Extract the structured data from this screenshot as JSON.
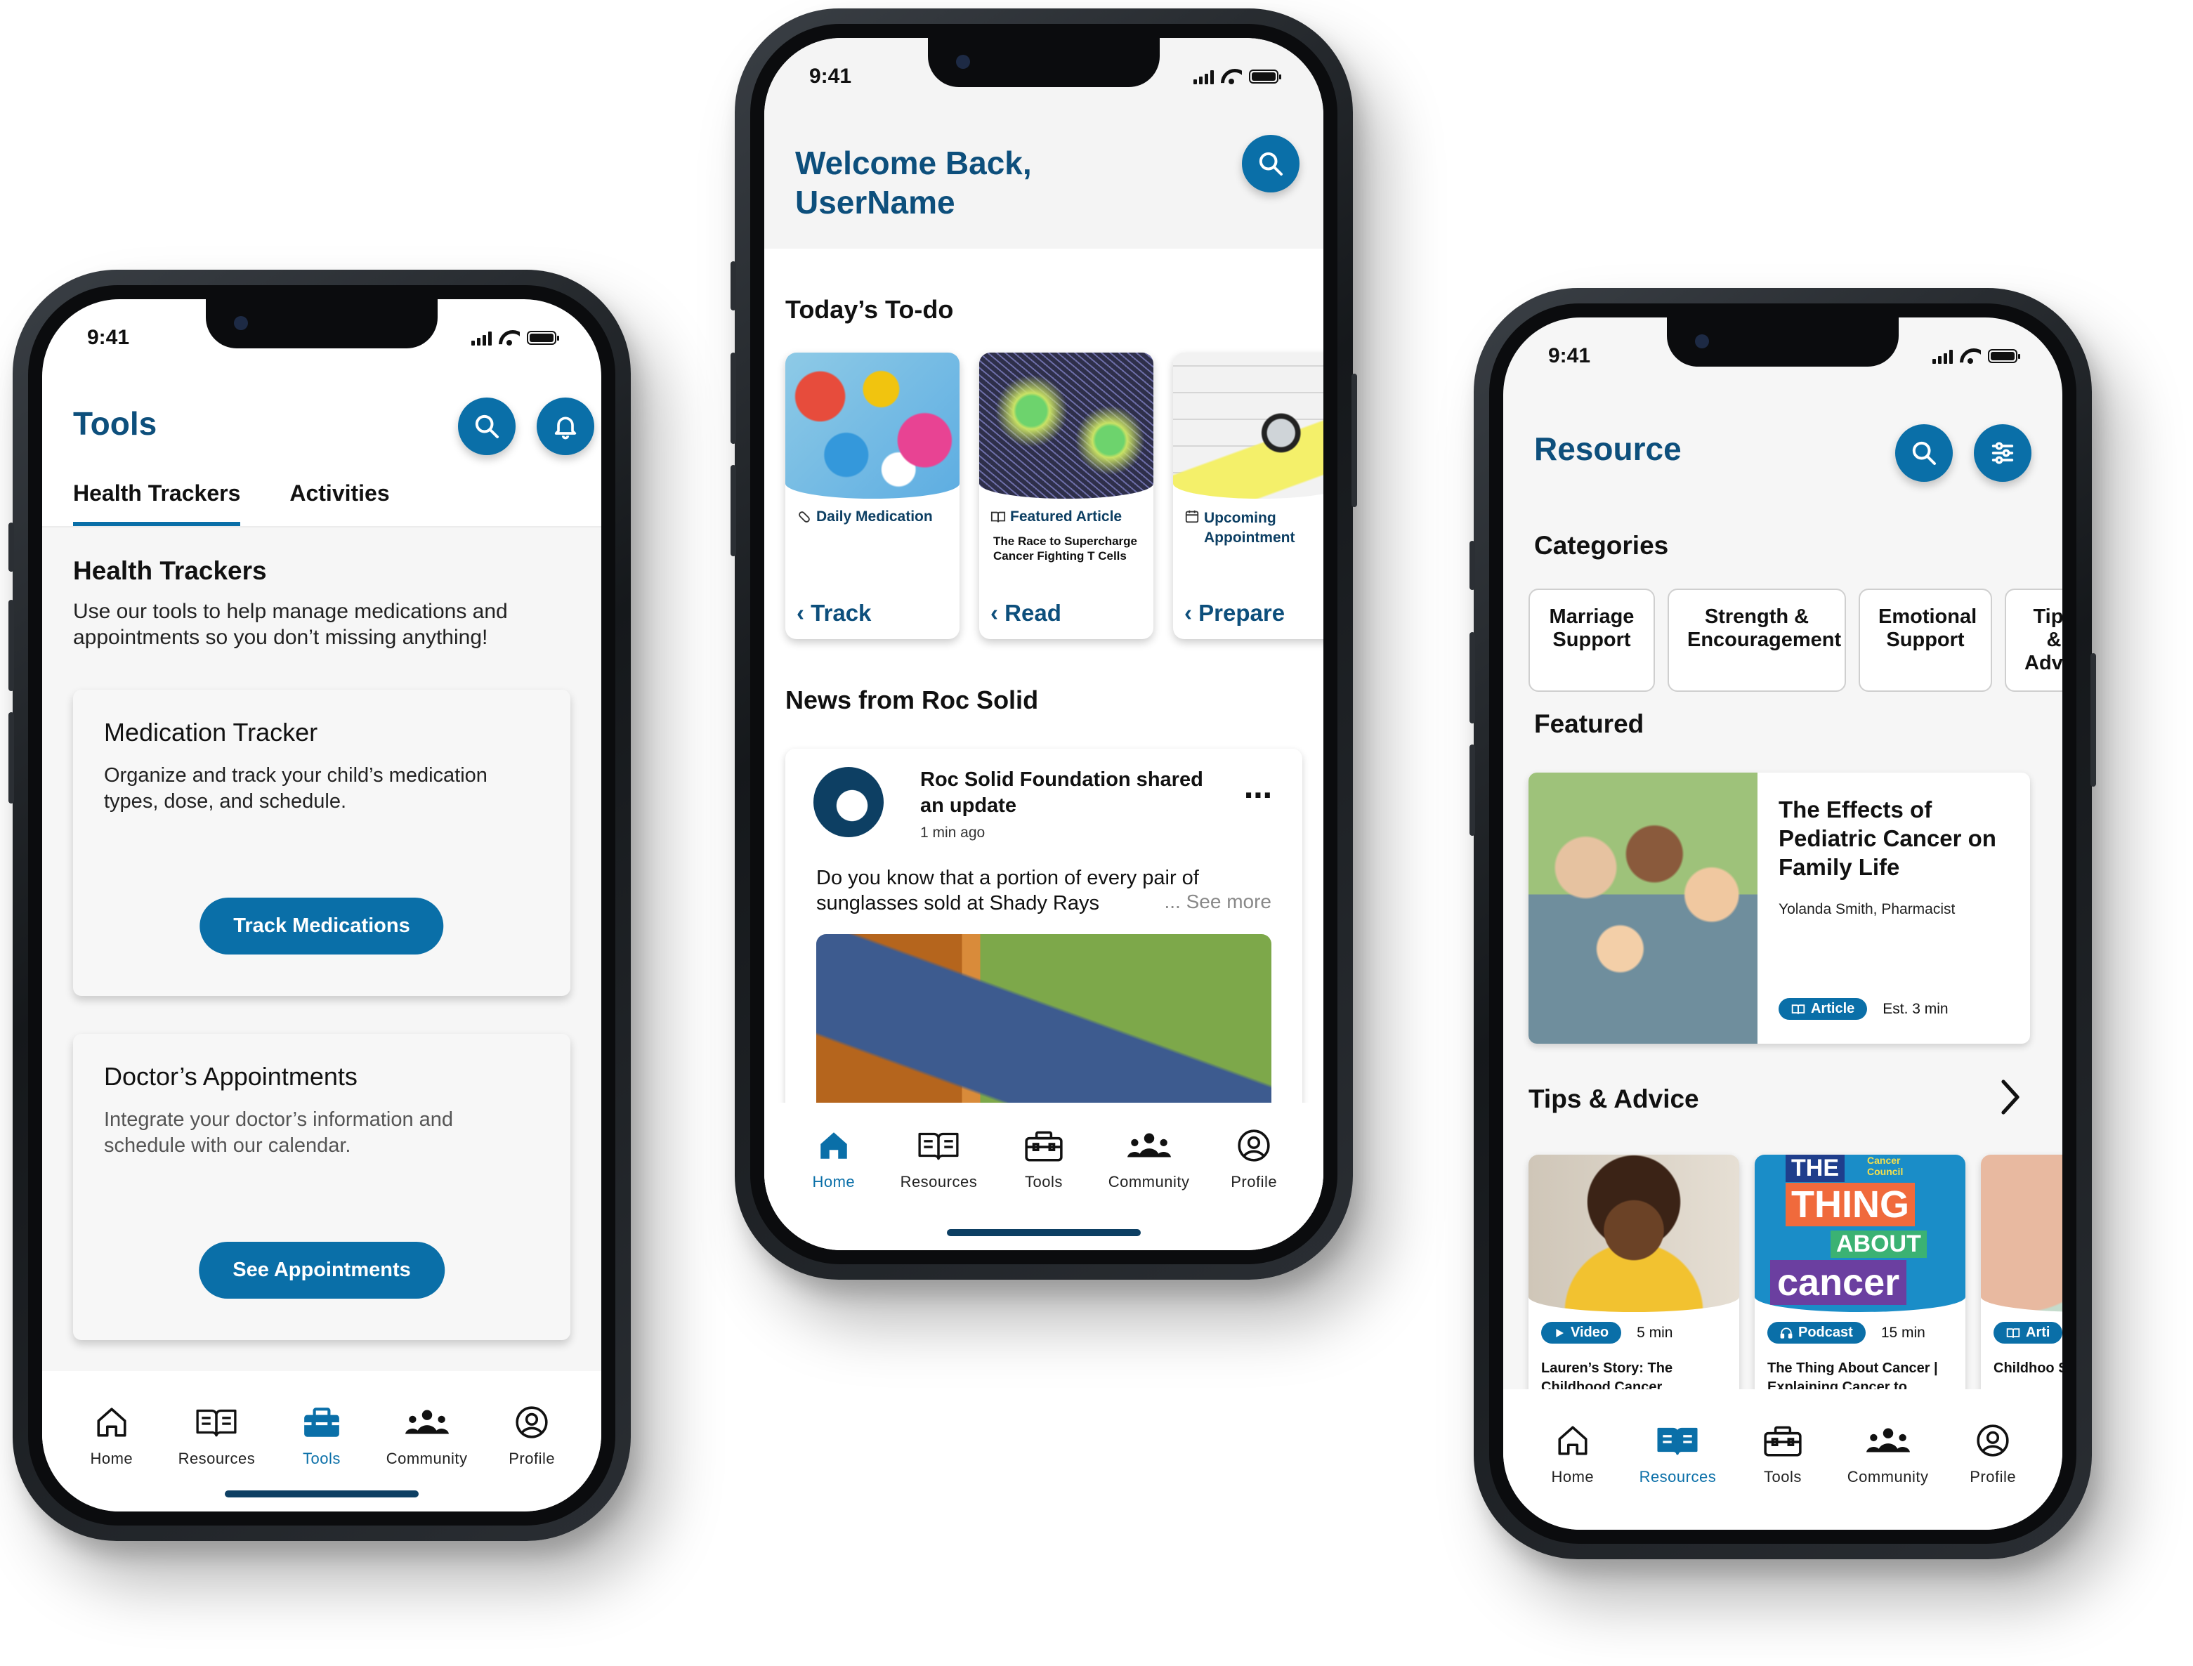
{
  "status_time": "9:41",
  "colors": {
    "primary": "#0a6fa8",
    "title": "#0d4f7c",
    "nav_active": "#0a6fa8"
  },
  "nav": {
    "home": "Home",
    "resources": "Resources",
    "tools": "Tools",
    "community": "Community",
    "profile": "Profile"
  },
  "tools_screen": {
    "title": "Tools",
    "tabs": [
      "Health Trackers",
      "Activities"
    ],
    "active_tab": "Health Trackers",
    "section_title": "Health Trackers",
    "section_desc": "Use our tools to help manage medications and appointments so you don’t missing anything!",
    "cards": [
      {
        "title": "Medication Tracker",
        "desc": "Organize and track your child’s medication types, dose, and schedule.",
        "button": "Track Medications"
      },
      {
        "title": "Doctor’s Appointments",
        "desc": "Integrate your doctor’s information and schedule with our calendar.",
        "button": "See Appointments"
      }
    ],
    "active_nav": "Tools"
  },
  "home_screen": {
    "welcome": "Welcome Back,",
    "username": "UserName",
    "todo_title": "Today’s To-do",
    "todos": [
      {
        "tag": "Daily Medication",
        "desc": "",
        "action": "Track",
        "icon": "pill-icon"
      },
      {
        "tag": "Featured Article",
        "desc": "The Race to Supercharge Cancer Fighting T Cells",
        "action": "Read",
        "icon": "book-icon"
      },
      {
        "tag": "Upcoming Appointment",
        "desc": "",
        "action": "Prepare",
        "icon": "calendar-icon"
      }
    ],
    "news_title": "News from Roc Solid",
    "post": {
      "author": "Roc Solid Foundation shared an update",
      "time": "1 min ago",
      "text": "Do you know that a portion of every pair of sunglasses sold at Shady Rays",
      "see_more": "... See more"
    },
    "active_nav": "Home"
  },
  "resource_screen": {
    "title": "Resource",
    "categories_title": "Categories",
    "categories": [
      "Marriage Support",
      "Strength & Encouragement",
      "Emotional Support",
      "Tips & Advice"
    ],
    "featured_title": "Featured",
    "featured": {
      "title": "The Effects of Pediatric Cancer on Family Life",
      "author": "Yolanda Smith, Pharmacist",
      "badge": "Article",
      "time": "Est. 3 min"
    },
    "tips_title": "Tips & Advice",
    "tips": [
      {
        "badge": "Video",
        "time": "5 min",
        "title": "Lauren’s Story: The Childhood Cancer"
      },
      {
        "badge": "Podcast",
        "time": "15 min",
        "title": "The Thing About Cancer | Explaining Cancer to"
      },
      {
        "badge": "Arti",
        "time": "",
        "title": "Childhoo Survivors"
      }
    ],
    "podcast_art": {
      "the": "THE",
      "thing": "THING",
      "about": "ABOUT",
      "cancer": "cancer",
      "council": "Cancer Council"
    },
    "active_nav": "Resources"
  }
}
